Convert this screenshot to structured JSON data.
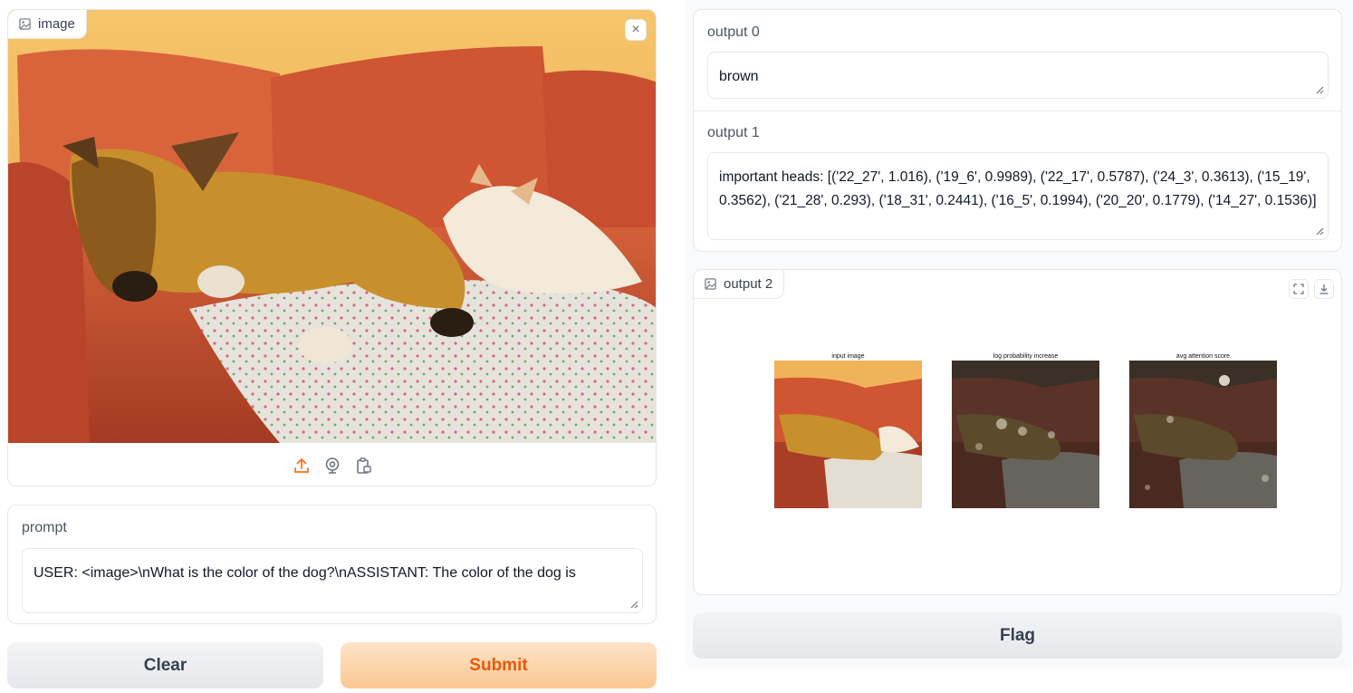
{
  "image_input": {
    "label": "image",
    "close_glyph": "×",
    "toolbar_icons": [
      "upload-icon",
      "webcam-icon",
      "clipboard-icon"
    ]
  },
  "prompt": {
    "label": "prompt",
    "value": "USER: <image>\\nWhat is the color of the dog?\\nASSISTANT: The color of the dog is"
  },
  "buttons": {
    "clear": "Clear",
    "submit": "Submit",
    "flag": "Flag"
  },
  "output0": {
    "label": "output 0",
    "value": "brown"
  },
  "output1": {
    "label": "output 1",
    "value": "important heads: [('22_27', 1.016), ('19_6', 0.9989), ('22_17', 0.5787), ('24_3', 0.3613), ('15_19', 0.3562), ('21_28', 0.293), ('18_31', 0.2441), ('16_5', 0.1994), ('20_20', 0.1779), ('14_27', 0.1536)]"
  },
  "output2": {
    "label": "output 2",
    "figures": [
      {
        "title": "input image"
      },
      {
        "title": "log probability increase"
      },
      {
        "title": "avg attention score"
      }
    ]
  },
  "colors": {
    "accent": "#f97316",
    "submit_text": "#ea580c",
    "sofa": "#c4502e",
    "wall": "#f3b660"
  }
}
